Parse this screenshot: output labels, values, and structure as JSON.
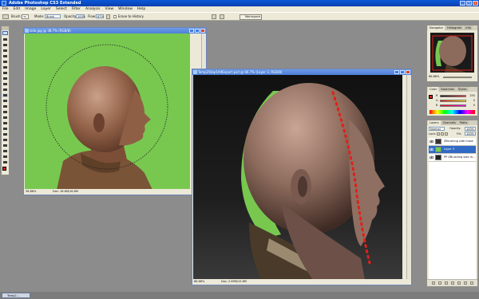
{
  "app": {
    "title": "Adobe Photoshop CS3 Extended"
  },
  "menu": [
    "File",
    "Edit",
    "Image",
    "Layer",
    "Select",
    "Filter",
    "Analysis",
    "View",
    "Window",
    "Help"
  ],
  "options": {
    "brush_label": "Brush:",
    "brush_size": "30",
    "mode_label": "Mode:",
    "mode_value": "Brush",
    "opacity_label": "Opacity:",
    "opacity_value": "100%",
    "flow_label": "Flow:",
    "flow_value": "67%",
    "erase_history": "Erase to History",
    "workspace": "Workspace"
  },
  "doc1": {
    "title": "side.jpg @ 38.7% (RGB/8)",
    "zoom": "38.66%",
    "doc_size": "Doc: 16.6M/16.6M"
  },
  "doc2": {
    "title": "Temp2Step1AltExport.psd @ 66.7% (Layer 3, RGB/8)",
    "zoom": "66.66%",
    "doc_size": "Doc: 2.69M/15.8M"
  },
  "navigator": {
    "tabs": [
      "Navigator",
      "Histogram",
      "Info"
    ],
    "zoom": "66.66%"
  },
  "color": {
    "tabs": [
      "Color",
      "Swatches",
      "Styles"
    ],
    "channels": [
      {
        "label": "R",
        "value": "255",
        "color": "#ff3030"
      },
      {
        "label": "G",
        "value": "0",
        "color": "#30a030"
      },
      {
        "label": "B",
        "value": "0",
        "color": "#3050ff"
      }
    ]
  },
  "layers": {
    "tabs": [
      "Layers",
      "Channels",
      "Paths"
    ],
    "blend_mode": "Normal",
    "opacity_label": "Opacity:",
    "opacity": "100%",
    "lock_label": "Lock:",
    "fill_label": "Fill:",
    "fill": "100%",
    "items": [
      {
        "name": "ZBrushing side mask",
        "selected": false,
        "thumb": "#3a3230"
      },
      {
        "name": "Layer 3",
        "selected": true,
        "thumb": "#6fcf4f"
      },
      {
        "name": "PP ZBrushing side m...",
        "selected": false,
        "thumb": "#222222"
      }
    ]
  },
  "taskbar": {
    "item": "Temp2..."
  },
  "colors": {
    "accent": "#0a3fb0",
    "greenscreen": "#78c850",
    "selection_red": "#e0201a"
  }
}
